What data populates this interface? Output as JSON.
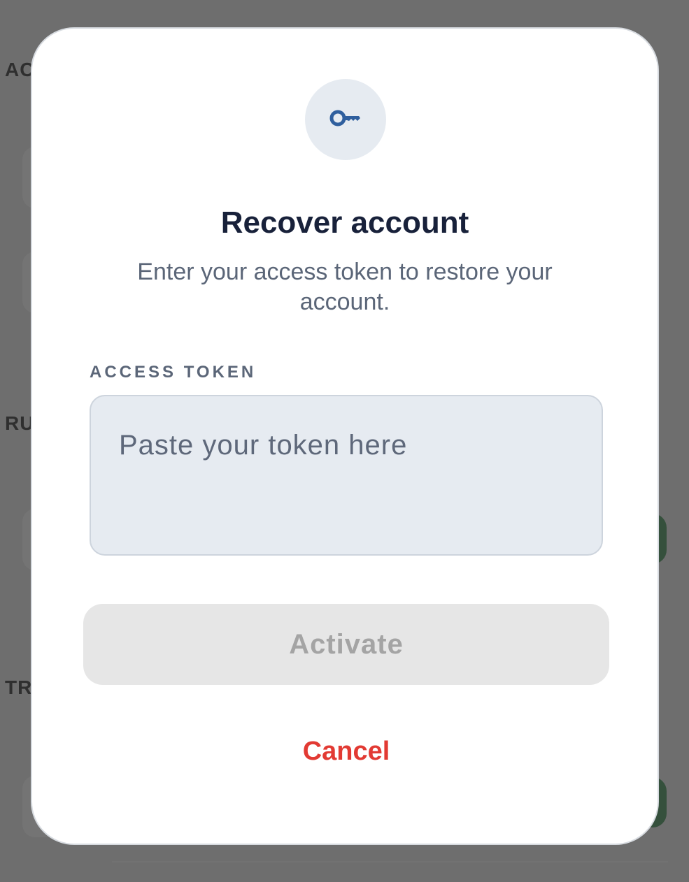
{
  "background": {
    "section_labels": [
      "AC",
      "RU",
      "TR"
    ]
  },
  "modal": {
    "icon": "key-icon",
    "title": "Recover account",
    "subtitle": "Enter your access token to restore your account.",
    "field_label": "ACCESS TOKEN",
    "token_input": {
      "value": "",
      "placeholder": "Paste your token here"
    },
    "activate_label": "Activate",
    "cancel_label": "Cancel"
  },
  "colors": {
    "accent": "#2f5f9e",
    "danger": "#e23a33",
    "disabled_bg": "#e6e6e6",
    "disabled_text": "#a4a4a4"
  }
}
